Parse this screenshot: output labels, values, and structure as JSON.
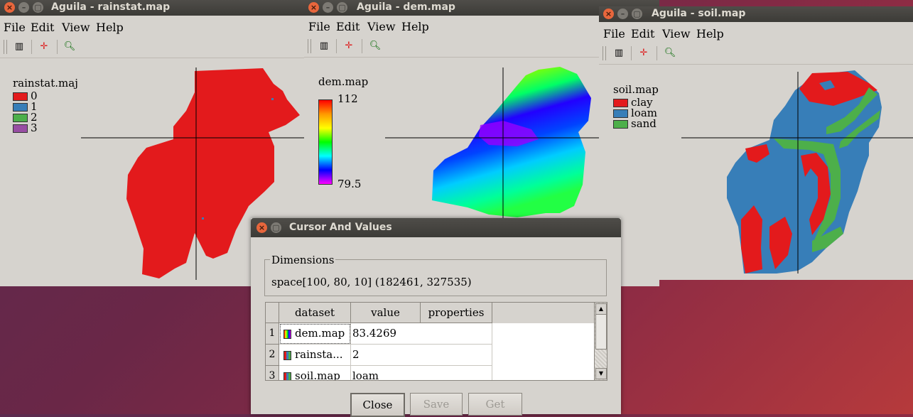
{
  "windows": {
    "rainstat": {
      "title": "Aguila - rainstat.map",
      "menu": [
        "File",
        "Edit",
        "View",
        "Help"
      ],
      "legend_title": "rainstat.maj",
      "legend": [
        {
          "label": "0",
          "color": "#e31a1c"
        },
        {
          "label": "1",
          "color": "#377eb8"
        },
        {
          "label": "2",
          "color": "#4daf4a"
        },
        {
          "label": "3",
          "color": "#984ea3"
        }
      ]
    },
    "dem": {
      "title": "Aguila - dem.map",
      "menu": [
        "File",
        "Edit",
        "View",
        "Help"
      ],
      "legend_title": "dem.map",
      "legend_max": "112",
      "legend_min": "79.5"
    },
    "soil": {
      "title": "Aguila - soil.map",
      "menu": [
        "File",
        "Edit",
        "View",
        "Help"
      ],
      "legend_title": "soil.map",
      "legend": [
        {
          "label": "clay",
          "color": "#e31a1c"
        },
        {
          "label": "loam",
          "color": "#377eb8"
        },
        {
          "label": "sand",
          "color": "#4daf4a"
        }
      ]
    }
  },
  "dialog": {
    "title": "Cursor And Values",
    "dimensions_label": "Dimensions",
    "dimensions_value": "space[100, 80, 10] (182461, 327535)",
    "columns": [
      "dataset",
      "value",
      "properties"
    ],
    "rows": [
      {
        "index": "1",
        "dataset": "dem.map",
        "value": "83.4269",
        "properties": ""
      },
      {
        "index": "2",
        "dataset": "rainsta...",
        "value": "2",
        "properties": ""
      },
      {
        "index": "3",
        "dataset": "soil.map",
        "value": "loam",
        "properties": ""
      }
    ],
    "buttons": {
      "close": "Close",
      "save": "Save",
      "get": "Get"
    }
  }
}
